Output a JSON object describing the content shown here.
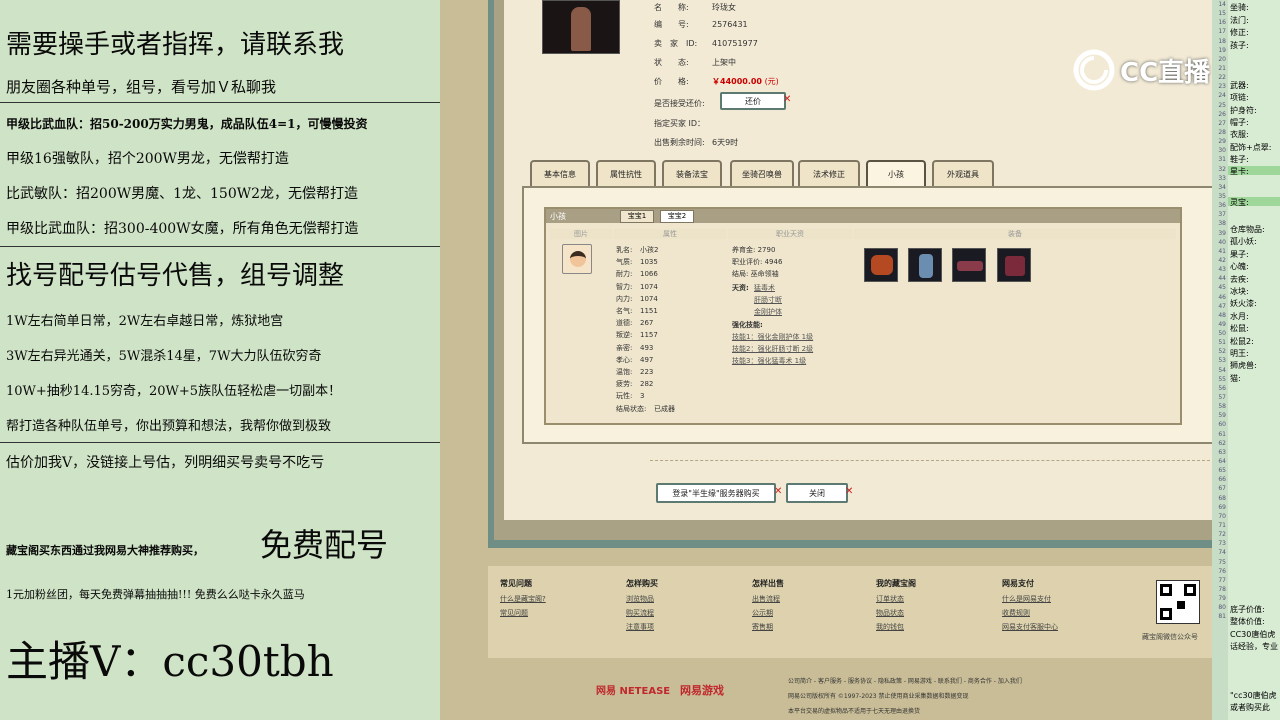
{
  "left_panel": {
    "lines": [
      "需要操手或者指挥，请联系我",
      "朋友圈各种单号，组号，看号加Ｖ私聊我",
      "甲级比武血队：招50-200万实力男鬼，成品队伍4=1，可慢慢投资",
      "甲级16强敏队，招个200W男龙，无偿帮打造",
      "比武敏队：招200W男魔、1龙、150W2龙，无偿帮打造",
      "甲级比武血队：招300-400W女魔，所有角色无偿帮打造",
      "找号配号估号代售，组号调整",
      "1W左右简单日常，2W左右卓越日常，炼狱地宫",
      "3W左右异光通关，5W混杀14星，7W大力队伍砍穷奇",
      "10W+抽秒14.15穷奇，20W+5族队伍轻松虐一切副本！",
      "帮打造各种队伍单号，你出预算和想法，我帮你做到极致",
      "估价加我V，没链接上号估，列明细买号卖号不吃亏",
      "藏宝阁买东西通过我网易大神推荐购买，",
      "免费配号",
      "1元加粉丝团，每天免费弹幕抽抽抽!!! 免费么么哒卡永久蓝马",
      "主播V：cc30tbh"
    ]
  },
  "item_info": {
    "name_label": "名　　称:",
    "name_value": "玲珑女",
    "id_label": "编　　号:",
    "id_value": "2576431",
    "seller_label": "卖　家　ID:",
    "seller_value": "410751977",
    "status_label": "状　　态:",
    "status_value": "上架中",
    "price_label": "价　　格:",
    "price_value": "￥44000.00",
    "price_unit": "(元)",
    "bargain_label": "是否接受还价:",
    "bargain_button": "还价",
    "buyer_label": "指定买家 ID：",
    "time_label": "出售剩余时间:",
    "time_value": "6天9时"
  },
  "tabs": [
    "基本信息",
    "属性抗性",
    "装备法宝",
    "坐骑召唤兽",
    "法术修正",
    "小孩",
    "外观道具"
  ],
  "child_panel": {
    "title": "小孩",
    "subtabs": [
      "宝宝1",
      "宝宝2"
    ],
    "headers": [
      "图片",
      "属性",
      "职业天资",
      "装备"
    ],
    "attrs_left": [
      {
        "k": "乳名:",
        "v": "小孩2"
      },
      {
        "k": "气质:",
        "v": "1035"
      },
      {
        "k": "耐力:",
        "v": "1066"
      },
      {
        "k": "智力:",
        "v": "1074"
      },
      {
        "k": "内力:",
        "v": "1074"
      },
      {
        "k": "名气:",
        "v": "1151"
      },
      {
        "k": "道德:",
        "v": "267"
      },
      {
        "k": "叛逆:",
        "v": "1157"
      },
      {
        "k": "亲密:",
        "v": "493"
      },
      {
        "k": "孝心:",
        "v": "497"
      },
      {
        "k": "温饱:",
        "v": "223"
      },
      {
        "k": "疲劳:",
        "v": "282"
      },
      {
        "k": "玩性:",
        "v": "3"
      },
      {
        "k": "结局状态:",
        "v": "已成器"
      }
    ],
    "raise_label": "养育金:",
    "raise_value": "2790",
    "rating_label": "职业评价:",
    "rating_value": "4946",
    "ending_label": "结局:",
    "ending_value": "巫命领袖",
    "talent_label": "天资:",
    "talents": [
      "猛毒术",
      "肝肠寸断",
      "金刚护体"
    ],
    "skill_label": "强化技能:",
    "skills": [
      "技能1：强化金刚护体 1级",
      "技能2：强化肝肠寸断 2级",
      "技能3：强化猛毒术 1级"
    ]
  },
  "buttons": {
    "buy": "登录\"半生缘\"服务器购买",
    "close": "关闭"
  },
  "footer": {
    "cols": [
      {
        "h": "常见问题",
        "links": [
          "什么是藏宝阁?",
          "常见问题"
        ]
      },
      {
        "h": "怎样购买",
        "links": [
          "浏览物品",
          "购买流程",
          "注意事项"
        ]
      },
      {
        "h": "怎样出售",
        "links": [
          "出售流程",
          "公示期",
          "寄售期"
        ]
      },
      {
        "h": "我的藏宝阁",
        "links": [
          "订单状态",
          "物品状态",
          "我的钱包"
        ]
      },
      {
        "h": "网易支付",
        "links": [
          "什么是网易支付",
          "收费规则",
          "网易支付客服中心"
        ]
      }
    ],
    "qr_caption": "藏宝阁微信公众号",
    "brand1": "网易 NETEASE",
    "brand2": "网易游戏",
    "legal": [
      "公司简介 - 客户服务 - 服务协议 - 隐私政策 - 网易游戏 - 联系我们 - 商务合作 - 加入我们",
      "网易公司版权所有 ©1997-2023 禁止使用商业采集数据和数据变现",
      "本平台交易的虚拟物品不适用于七天无理由退换货"
    ]
  },
  "overlay": {
    "logo": "CC直播"
  },
  "right_col": {
    "line_numbers": [
      "14",
      "15",
      "16",
      "17",
      "18",
      "19",
      "20",
      "21",
      "22",
      "23",
      "24",
      "25",
      "26",
      "27",
      "28",
      "29",
      "30",
      "31",
      "32",
      "33",
      "34",
      "35",
      "36",
      "37",
      "38",
      "39",
      "40",
      "41",
      "42",
      "43",
      "44",
      "45",
      "46",
      "47",
      "48",
      "49",
      "50",
      "51",
      "52",
      "53",
      "54",
      "55",
      "56",
      "57",
      "58",
      "59",
      "60",
      "61",
      "62",
      "63",
      "64",
      "65",
      "66",
      "67",
      "68",
      "69",
      "70",
      "71",
      "72",
      "73",
      "74",
      "75",
      "76",
      "77",
      "78",
      "79",
      "80",
      "81"
    ],
    "labels_top": [
      "坐骑:",
      "法门:",
      "修正:",
      "孩子:"
    ],
    "labels_mid": [
      "武器:",
      "项链:",
      "护身符:",
      "帽子:",
      "衣服:",
      "配饰+点翠:",
      "鞋子:",
      "星卡:"
    ],
    "label_treasure": "灵宝:",
    "labels_low": [
      "仓库物品:",
      "孤小妖:",
      "果子:",
      "心魄:",
      "去疾:",
      "冰块:",
      "妖火漆:",
      "水月:",
      "松鼠:",
      "松鼠2:",
      "明王:",
      "狮虎兽:",
      "猫:"
    ],
    "labels_bottom": [
      "底子价值:",
      "整体价值:",
      "CC30唐伯虎",
      "话经验，专业"
    ],
    "chat": [
      "\"cc30唐伯虎",
      "或者购买此"
    ]
  }
}
